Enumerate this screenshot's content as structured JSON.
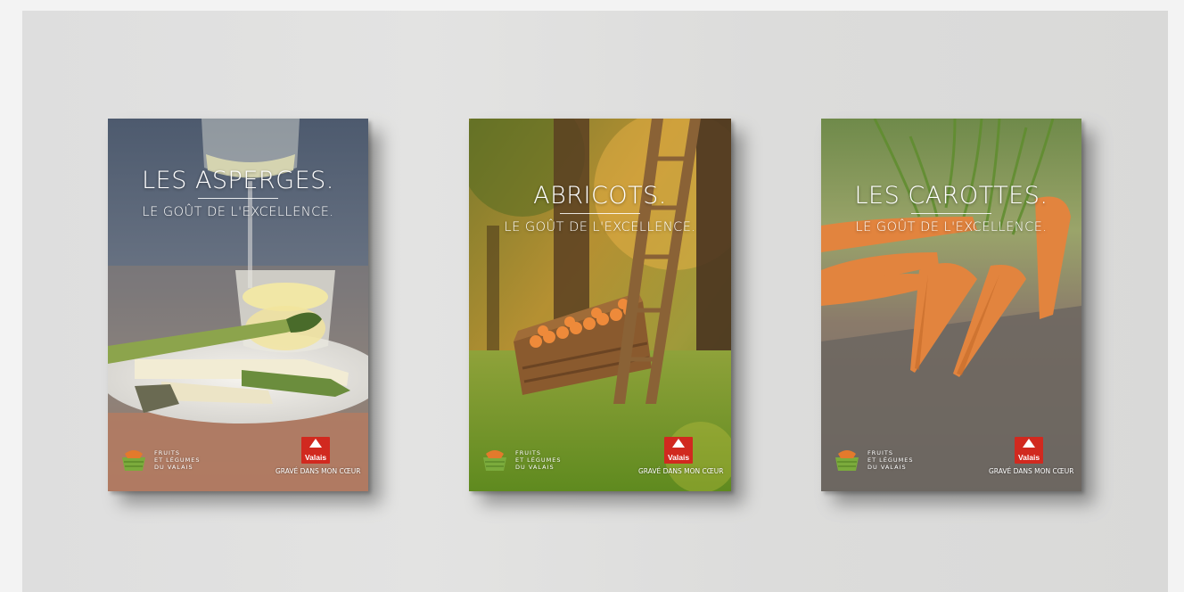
{
  "brochures": [
    {
      "title": "LES ASPERGES.",
      "tagline": "LE GOÛT DE L'EXCELLENCE.",
      "logo_text": [
        "FRUITS",
        "ET LÉGUMES",
        "DU VALAIS"
      ],
      "badge": "Valais",
      "slogan": "GRAVÉ DANS MON CŒUR"
    },
    {
      "title": "ABRICOTS.",
      "tagline": "LE GOÛT DE L'EXCELLENCE.",
      "logo_text": [
        "FRUITS",
        "ET LÉGUMES",
        "DU VALAIS"
      ],
      "badge": "Valais",
      "slogan": "GRAVÉ DANS MON CŒUR"
    },
    {
      "title": "LES CAROTTES.",
      "tagline": "LE GOÛT DE L'EXCELLENCE.",
      "logo_text": [
        "FRUITS",
        "ET LÉGUMES",
        "DU VALAIS"
      ],
      "badge": "Valais",
      "slogan": "GRAVÉ DANS MON CŒUR"
    }
  ]
}
